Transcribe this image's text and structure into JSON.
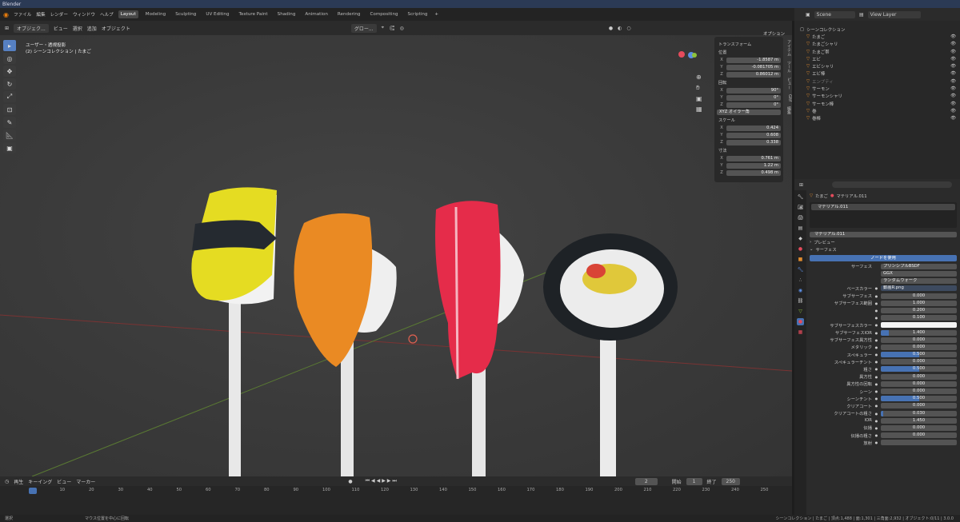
{
  "app": {
    "title": "Blender"
  },
  "menu": [
    "ファイル",
    "編集",
    "レンダー",
    "ウィンドウ",
    "ヘルプ"
  ],
  "workspaces": [
    "Layout",
    "Modeling",
    "Sculpting",
    "UV Editing",
    "Texture Paint",
    "Shading",
    "Animation",
    "Rendering",
    "Compositing",
    "Scripting"
  ],
  "active_workspace": "Layout",
  "scene": {
    "label": "Scene",
    "view_layer": "View Layer"
  },
  "viewport_header": {
    "mode": "オブジェク...",
    "items": [
      "ビュー",
      "選択",
      "追加",
      "オブジェクト"
    ],
    "orientation": "グロー...",
    "options": "オプション"
  },
  "viewport_overlay": {
    "view": "ユーザー・透視投影",
    "collection": "(2) シーンコレクション | たまご"
  },
  "transform": {
    "title": "トランスフォーム",
    "location_label": "位置",
    "location": [
      {
        "axis": "X",
        "value": "-1.8587 m"
      },
      {
        "axis": "Y",
        "value": "-0.081705 m"
      },
      {
        "axis": "Z",
        "value": "0.86012 m"
      }
    ],
    "rotation_label": "回転",
    "rotation": [
      {
        "axis": "X",
        "value": "90°"
      },
      {
        "axis": "Y",
        "value": "0°"
      },
      {
        "axis": "Z",
        "value": "0°"
      }
    ],
    "rotation_mode": "XYZ オイラー角",
    "scale_label": "スケール",
    "scale": [
      {
        "axis": "X",
        "value": "0.424"
      },
      {
        "axis": "Y",
        "value": "0.608"
      },
      {
        "axis": "Z",
        "value": "0.338"
      }
    ],
    "dims_label": "寸法",
    "dimensions": [
      {
        "axis": "X",
        "value": "0.761 m"
      },
      {
        "axis": "Y",
        "value": "1.22 m"
      },
      {
        "axis": "Z",
        "value": "0.498 m"
      }
    ]
  },
  "n_tabs": [
    "アイテム",
    "ツール",
    "ビュー",
    "Gltf",
    "編集"
  ],
  "outliner": {
    "root": "シーンコレクション",
    "items": [
      {
        "name": "たまご",
        "dim": false
      },
      {
        "name": "たまごシャリ",
        "dim": false
      },
      {
        "name": "たまご帯",
        "dim": false
      },
      {
        "name": "エビ",
        "dim": false
      },
      {
        "name": "エビシャリ",
        "dim": false
      },
      {
        "name": "エビ棒",
        "dim": false
      },
      {
        "name": "エンプティ",
        "dim": true
      },
      {
        "name": "サーモン",
        "dim": false
      },
      {
        "name": "サーモンシャリ",
        "dim": false
      },
      {
        "name": "サーモン棒",
        "dim": false
      },
      {
        "name": "巻",
        "dim": false
      },
      {
        "name": "巻棒",
        "dim": false
      }
    ]
  },
  "properties": {
    "object": "たまご",
    "material": "マテリアル.011",
    "slot": "マテリアル.011",
    "preview": "プレビュー",
    "surface_section": "サーフェス",
    "use_nodes": "ノードを使用",
    "surface_label": "サーフェス",
    "surface_value": "プリンシプルBSDF",
    "dist": "GGX",
    "sss_method": "ランダムウォーク",
    "rows": [
      {
        "label": "ベースカラー",
        "value": "動画R.png",
        "fill": 0,
        "type": "tex"
      },
      {
        "label": "サブサーフェス",
        "value": "0.000",
        "fill": 0
      },
      {
        "label": "サブサーフェス範囲",
        "value": "1.000",
        "fill": 0
      },
      {
        "label": "",
        "value": "0.200",
        "fill": 0
      },
      {
        "label": "",
        "value": "0.100",
        "fill": 0
      },
      {
        "label": "サブサーフェスカラー",
        "value": "",
        "fill": 0,
        "type": "color"
      },
      {
        "label": "サブサーフェスIOR",
        "value": "1.400",
        "fill": 0.1
      },
      {
        "label": "サブサーフェス異方性",
        "value": "0.000",
        "fill": 0
      },
      {
        "label": "メタリック",
        "value": "0.000",
        "fill": 0
      },
      {
        "label": "スペキュラー",
        "value": "0.500",
        "fill": 0.5
      },
      {
        "label": "スペキュラーチント",
        "value": "0.000",
        "fill": 0
      },
      {
        "label": "粗さ",
        "value": "0.500",
        "fill": 0.5
      },
      {
        "label": "異方性",
        "value": "0.000",
        "fill": 0
      },
      {
        "label": "異方性の回転",
        "value": "0.000",
        "fill": 0
      },
      {
        "label": "シーン",
        "value": "0.000",
        "fill": 0
      },
      {
        "label": "シーンチント",
        "value": "0.500",
        "fill": 0.5
      },
      {
        "label": "クリアコート",
        "value": "0.000",
        "fill": 0
      },
      {
        "label": "クリアコートの粗さ",
        "value": "0.030",
        "fill": 0.03
      },
      {
        "label": "IOR",
        "value": "1.450",
        "fill": 0
      },
      {
        "label": "伝播",
        "value": "0.000",
        "fill": 0
      },
      {
        "label": "伝播の粗さ",
        "value": "0.000",
        "fill": 0
      },
      {
        "label": "放射",
        "value": "",
        "fill": 0
      }
    ]
  },
  "timeline": {
    "items": [
      "再生",
      "キーイング",
      "ビュー",
      "マーカー"
    ],
    "current": "2",
    "start_label": "開始",
    "start": "1",
    "end_label": "終了",
    "end": "250",
    "ticks": [
      "0",
      "10",
      "20",
      "30",
      "40",
      "50",
      "60",
      "70",
      "80",
      "90",
      "100",
      "110",
      "120",
      "130",
      "140",
      "150",
      "160",
      "170",
      "180",
      "190",
      "200",
      "210",
      "220",
      "230",
      "240",
      "250"
    ]
  },
  "status": {
    "select": "選択",
    "hint": "マウス位置を中心に回転",
    "stats": "シーンコレクション | たまご | 頂点:1,488 | 面:1,301 | 三角面:2,932 | オブジェクト:0/11 | 3.0.0"
  }
}
